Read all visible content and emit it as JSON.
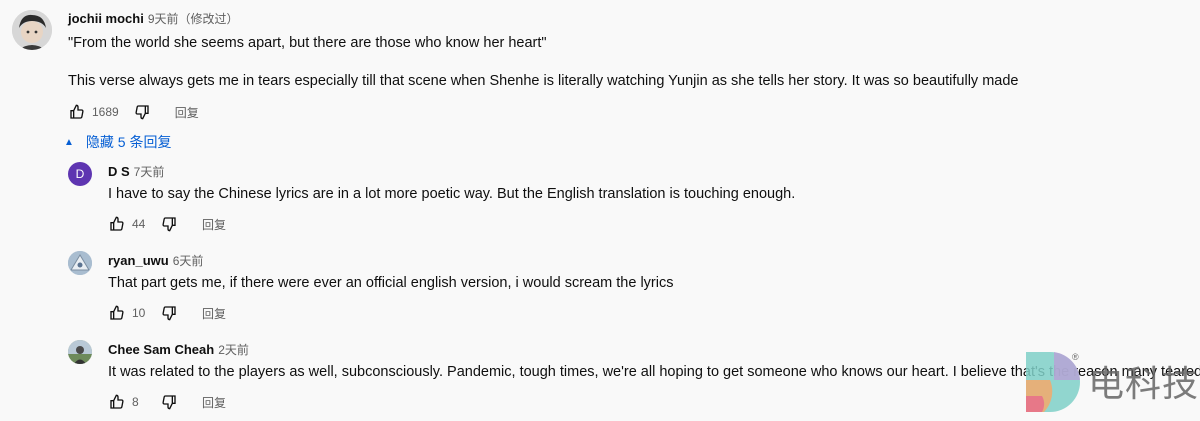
{
  "top_comment": {
    "author": "jochii mochi",
    "time": "9天前（修改过）",
    "line1": "\"From the world she seems apart, but there are those who know her heart\"",
    "line2": "This verse always gets me in tears especially till that scene when Shenhe is literally watching Yunjin as she tells her story. It was so beautifully made",
    "likes": "1689",
    "reply_label": "回复"
  },
  "toggle": {
    "label": "隐藏 5 条回复"
  },
  "replies": [
    {
      "author": "D S",
      "time": "7天前",
      "avatar_letter": "D",
      "text": "I have to say the Chinese lyrics are in a lot more poetic way. But the English translation is touching enough.",
      "likes": "44",
      "reply_label": "回复"
    },
    {
      "author": "ryan_uwu",
      "time": "6天前",
      "text": "That part gets me, if there were ever an official english version, i would scream the lyrics",
      "likes": "10",
      "reply_label": "回复"
    },
    {
      "author": "Chee Sam Cheah",
      "time": "2天前",
      "text": "It was related to the players as well, subconsciously. Pandemic, tough times, we're all hoping to get someone who knows our heart. I believe that's the reason many teared up.",
      "likes": "8",
      "reply_label": "回复"
    }
  ],
  "watermark": {
    "text": "电科技",
    "registered": "®"
  },
  "colors": {
    "link": "#065fd4",
    "avatar_ds": "#5e35b1",
    "meta": "#606060"
  }
}
